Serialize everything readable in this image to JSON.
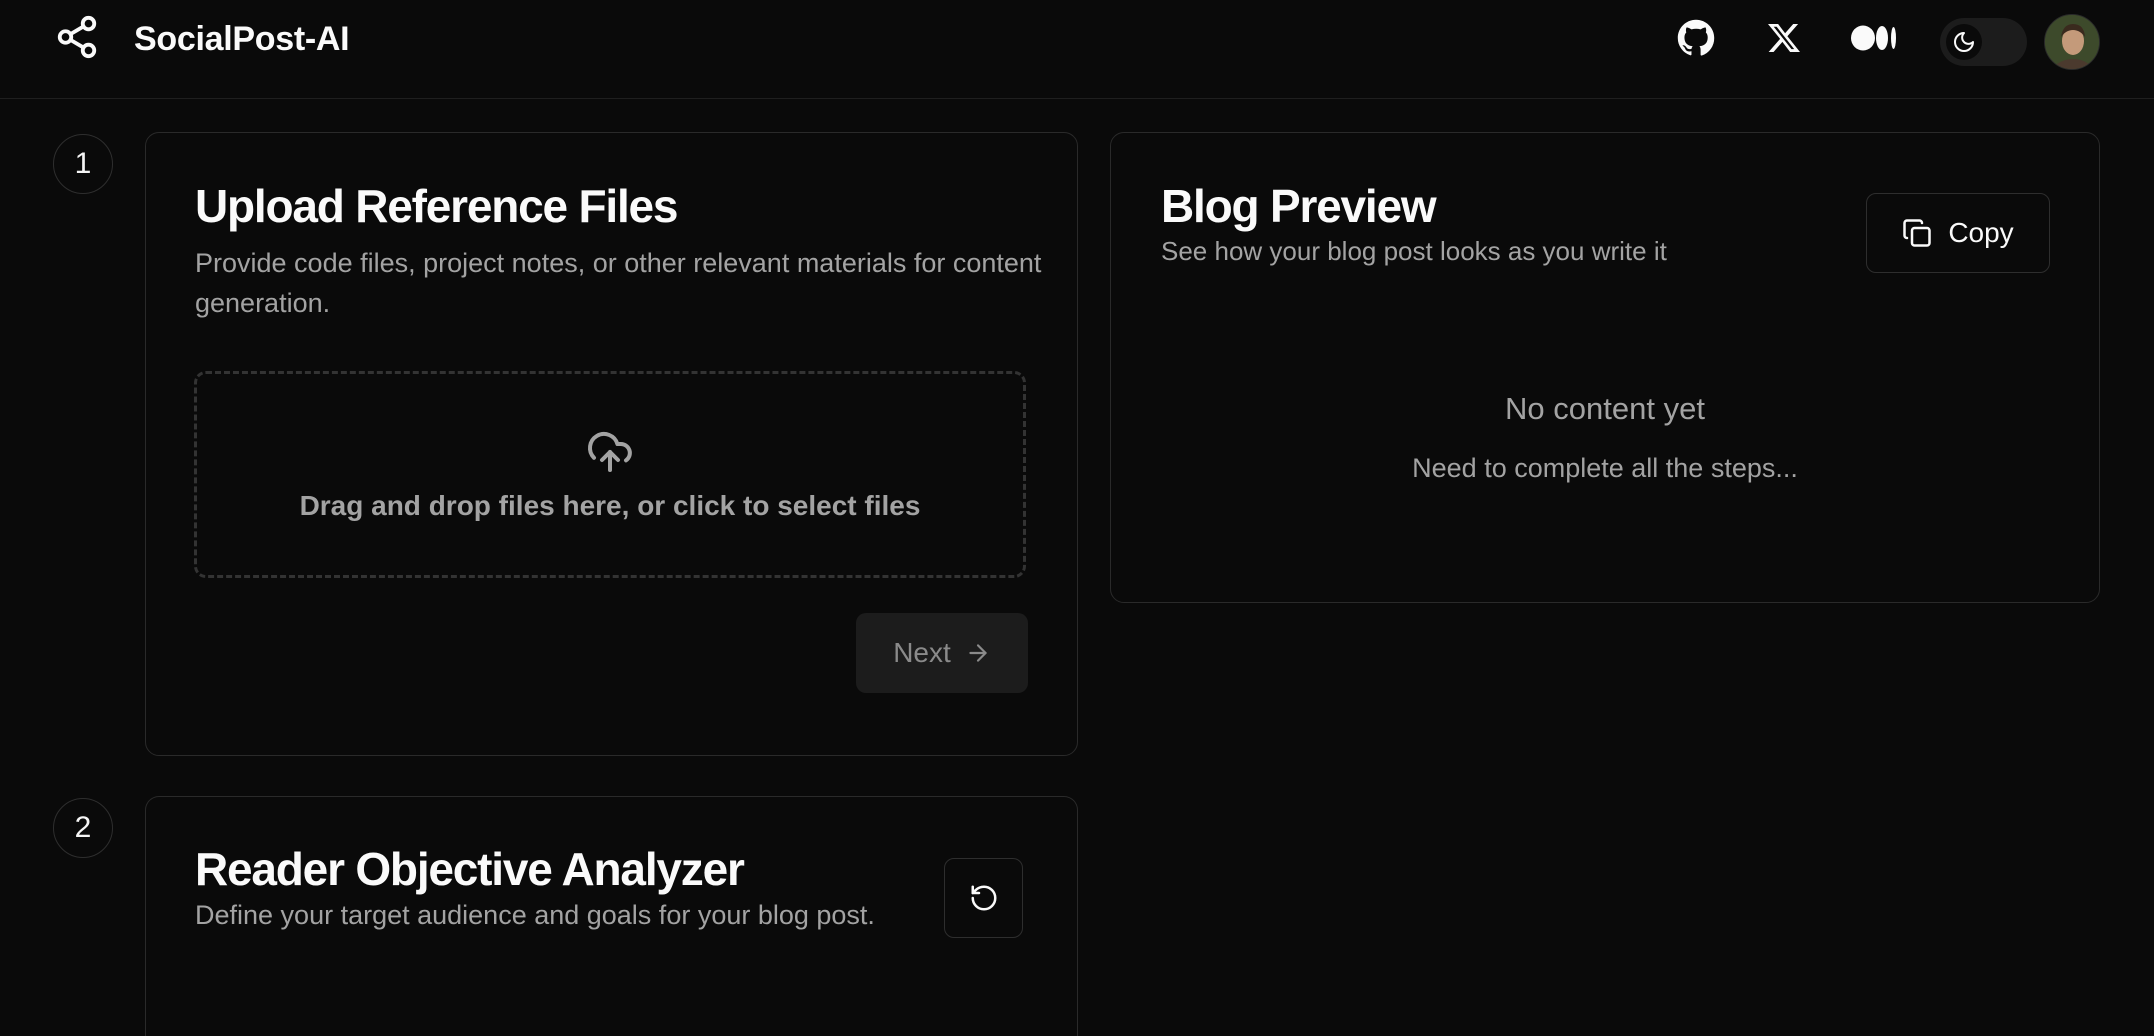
{
  "header": {
    "app_title": "SocialPost-AI",
    "logo_icon": "share-icon",
    "links": [
      {
        "name": "github-icon"
      },
      {
        "name": "x-icon"
      },
      {
        "name": "medium-icon"
      }
    ],
    "theme_toggle": {
      "state": "dark",
      "icon": "moon-icon"
    },
    "avatar": "avatar"
  },
  "steps": [
    {
      "number": "1",
      "title": "Upload Reference Files",
      "description": "Provide code files, project notes, or other relevant materials for content generation.",
      "dropzone_text": "Drag and drop files here, or click to select files",
      "next_label": "Next"
    },
    {
      "number": "2",
      "title": "Reader Objective Analyzer",
      "description": "Define your target audience and goals for your blog post."
    }
  ],
  "preview": {
    "title": "Blog Preview",
    "subtitle": "See how your blog post looks as you write it",
    "copy_label": "Copy",
    "empty_title": "No content yet",
    "empty_subtitle": "Need to complete all the steps..."
  },
  "colors": {
    "background": "#0a0a0a",
    "border": "#2a2a2a",
    "text": "#fafafa",
    "muted": "#a3a3a3"
  }
}
